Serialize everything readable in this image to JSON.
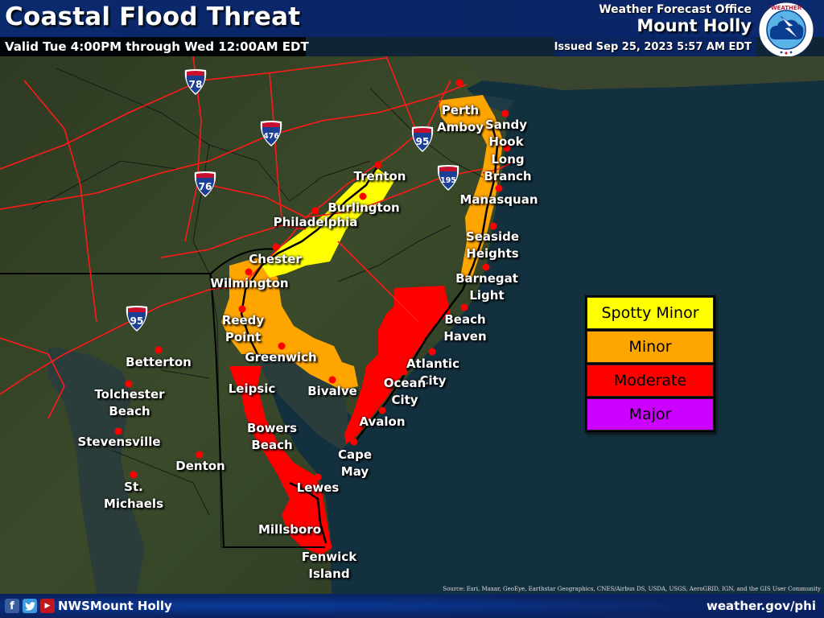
{
  "header": {
    "title": "Coastal Flood Threat",
    "valid": "Valid Tue 4:00PM through Wed 12:00AM EDT",
    "office_label": "Weather Forecast Office",
    "office_name": "Mount Holly",
    "issued": "Issued Sep 25, 2023 5:57 AM EDT",
    "logo": "nws-logo"
  },
  "legend": {
    "items": [
      {
        "label": "Spotty Minor",
        "color": "#ffff00"
      },
      {
        "label": "Minor",
        "color": "#ffa500"
      },
      {
        "label": "Moderate",
        "color": "#ff0000"
      },
      {
        "label": "Major",
        "color": "#cc00ff"
      }
    ]
  },
  "interstates": [
    {
      "number": "78"
    },
    {
      "number": "476"
    },
    {
      "number": "95"
    },
    {
      "number": "76"
    },
    {
      "number": "195"
    },
    {
      "number": "95"
    }
  ],
  "cities": [
    {
      "name": "Perth\nAmboy"
    },
    {
      "name": "Sandy\nHook"
    },
    {
      "name": "Long\nBranch"
    },
    {
      "name": "Manasquan"
    },
    {
      "name": "Seaside\nHeights"
    },
    {
      "name": "Barnegat\nLight"
    },
    {
      "name": "Beach\nHaven"
    },
    {
      "name": "Atlantic\nCity"
    },
    {
      "name": "Ocean\nCity"
    },
    {
      "name": "Avalon"
    },
    {
      "name": "Cape\nMay"
    },
    {
      "name": "Trenton"
    },
    {
      "name": "Burlington"
    },
    {
      "name": "Philadelphia"
    },
    {
      "name": "Chester"
    },
    {
      "name": "Wilmington"
    },
    {
      "name": "Reedy\nPoint"
    },
    {
      "name": "Greenwich"
    },
    {
      "name": "Bivalve"
    },
    {
      "name": "Leipsic"
    },
    {
      "name": "Bowers\nBeach"
    },
    {
      "name": "Lewes"
    },
    {
      "name": "Millsboro"
    },
    {
      "name": "Fenwick\nIsland"
    },
    {
      "name": "Betterton"
    },
    {
      "name": "Tolchester\nBeach"
    },
    {
      "name": "Stevensville"
    },
    {
      "name": "St.\nMichaels"
    },
    {
      "name": "Denton"
    }
  ],
  "source": "Source: Esri, Maxar, GeoEye, Earthstar Geographics, CNES/Airbus DS, USDA, USGS, AeroGRID, IGN, and the GIS User Community",
  "footer": {
    "social": [
      "facebook-icon",
      "twitter-icon",
      "youtube-icon"
    ],
    "handle": "NWSMount Holly",
    "website": "weather.gov/phi"
  }
}
